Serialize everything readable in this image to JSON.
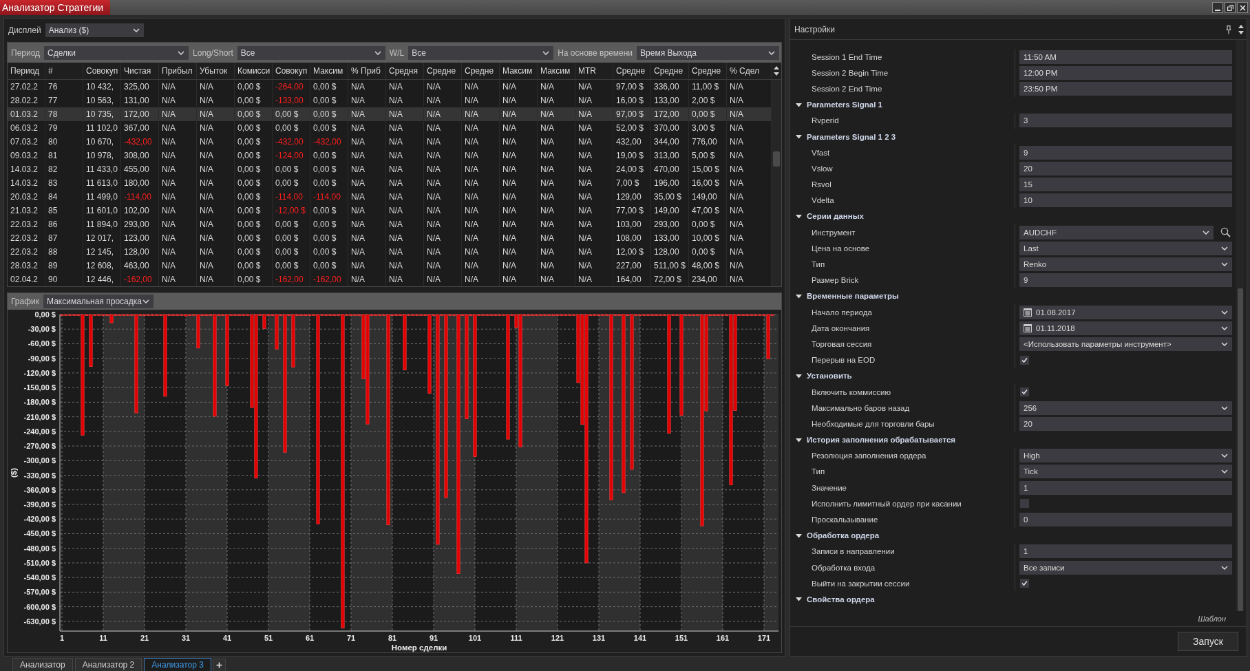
{
  "window": {
    "title": "Анализатор Стратегии"
  },
  "display": {
    "label": "Дисплей",
    "value": "Анализ ($)"
  },
  "filters": [
    {
      "label": "Период",
      "value": "Сделки"
    },
    {
      "label": "Long/Short",
      "value": "Все"
    },
    {
      "label": "W/L",
      "value": "Все"
    },
    {
      "label": "На основе времени",
      "value": "Время Выхода"
    }
  ],
  "table": {
    "columns": [
      "Период",
      "#",
      "Совокуп",
      "Чистая",
      "Прибыл",
      "Убыток",
      "Комисси",
      "Совокуп",
      "Максим",
      "% Приб",
      "Средня",
      "Средне",
      "Средне",
      "Максим",
      "Максим",
      "MTR",
      "Средне",
      "Средне",
      "Средне",
      "% Сдел"
    ],
    "rows": [
      {
        "selected": false,
        "cells": [
          "27.02.2",
          "76",
          "10 432,",
          "325,00",
          "N/A",
          "N/A",
          "0,00 $",
          {
            "text": "-264,00",
            "color": "#ff1e1e"
          },
          "0,00 $",
          "N/A",
          "N/A",
          "N/A",
          "N/A",
          "N/A",
          "N/A",
          "N/A",
          "97,00 $",
          "336,00",
          "11,00 $",
          "N/A"
        ]
      },
      {
        "selected": false,
        "cells": [
          "28.02.2",
          "77",
          "10 563,",
          "131,00",
          "N/A",
          "N/A",
          "0,00 $",
          {
            "text": "-133,00",
            "color": "#ff1e1e"
          },
          "0,00 $",
          "N/A",
          "N/A",
          "N/A",
          "N/A",
          "N/A",
          "N/A",
          "N/A",
          "16,00 $",
          "133,00",
          "2,00 $",
          "N/A"
        ]
      },
      {
        "selected": true,
        "cells": [
          "01.03.2",
          "78",
          "10 735,",
          "172,00",
          "N/A",
          "N/A",
          "0,00 $",
          "0,00 $",
          "0,00 $",
          "N/A",
          "N/A",
          "N/A",
          "N/A",
          "N/A",
          "N/A",
          "N/A",
          "97,00 $",
          "172,00",
          "0,00 $",
          "N/A"
        ]
      },
      {
        "selected": false,
        "cells": [
          "06.03.2",
          "79",
          "11 102,0",
          "367,00",
          "N/A",
          "N/A",
          "0,00 $",
          "0,00 $",
          "0,00 $",
          "N/A",
          "N/A",
          "N/A",
          "N/A",
          "N/A",
          "N/A",
          "N/A",
          "52,00 $",
          "370,00",
          "3,00 $",
          "N/A"
        ]
      },
      {
        "selected": false,
        "cells": [
          "07.03.2",
          "80",
          "10 670,",
          {
            "text": "-432,00",
            "color": "#ff1e1e"
          },
          "N/A",
          "N/A",
          "0,00 $",
          {
            "text": "-432,00",
            "color": "#ff1e1e"
          },
          {
            "text": "-432,00",
            "color": "#ff1e1e"
          },
          "N/A",
          "N/A",
          "N/A",
          "N/A",
          "N/A",
          "N/A",
          "N/A",
          "432,00",
          "344,00",
          "776,00",
          "N/A"
        ]
      },
      {
        "selected": false,
        "cells": [
          "09.03.2",
          "81",
          "10 978,",
          "308,00",
          "N/A",
          "N/A",
          "0,00 $",
          {
            "text": "-124,00",
            "color": "#ff1e1e"
          },
          "0,00 $",
          "N/A",
          "N/A",
          "N/A",
          "N/A",
          "N/A",
          "N/A",
          "N/A",
          "19,00 $",
          "313,00",
          "5,00 $",
          "N/A"
        ]
      },
      {
        "selected": false,
        "cells": [
          "14.03.2",
          "82",
          "11 433,0",
          "455,00",
          "N/A",
          "N/A",
          "0,00 $",
          "0,00 $",
          "0,00 $",
          "N/A",
          "N/A",
          "N/A",
          "N/A",
          "N/A",
          "N/A",
          "N/A",
          "24,00 $",
          "470,00",
          "15,00 $",
          "N/A"
        ]
      },
      {
        "selected": false,
        "cells": [
          "14.03.2",
          "83",
          "11 613,0",
          "180,00",
          "N/A",
          "N/A",
          "0,00 $",
          "0,00 $",
          "0,00 $",
          "N/A",
          "N/A",
          "N/A",
          "N/A",
          "N/A",
          "N/A",
          "N/A",
          "7,00 $",
          "196,00",
          "16,00 $",
          "N/A"
        ]
      },
      {
        "selected": false,
        "cells": [
          "20.03.2",
          "84",
          "11 499,0",
          {
            "text": "-114,00",
            "color": "#ff1e1e"
          },
          "N/A",
          "N/A",
          "0,00 $",
          {
            "text": "-114,00",
            "color": "#ff1e1e"
          },
          {
            "text": "-114,00",
            "color": "#ff1e1e"
          },
          "N/A",
          "N/A",
          "N/A",
          "N/A",
          "N/A",
          "N/A",
          "N/A",
          "129,00",
          "35,00 $",
          "149,00",
          "N/A"
        ]
      },
      {
        "selected": false,
        "cells": [
          "21.03.2",
          "85",
          "11 601,0",
          "102,00",
          "N/A",
          "N/A",
          "0,00 $",
          {
            "text": "-12,00 $",
            "color": "#ff1e1e"
          },
          "0,00 $",
          "N/A",
          "N/A",
          "N/A",
          "N/A",
          "N/A",
          "N/A",
          "N/A",
          "77,00 $",
          "149,00",
          "47,00 $",
          "N/A"
        ]
      },
      {
        "selected": false,
        "cells": [
          "22.03.2",
          "86",
          "11 894,0",
          "293,00",
          "N/A",
          "N/A",
          "0,00 $",
          "0,00 $",
          "0,00 $",
          "N/A",
          "N/A",
          "N/A",
          "N/A",
          "N/A",
          "N/A",
          "N/A",
          "103,00",
          "293,00",
          "0,00 $",
          "N/A"
        ]
      },
      {
        "selected": false,
        "cells": [
          "22.03.2",
          "87",
          "12 017,",
          "123,00",
          "N/A",
          "N/A",
          "0,00 $",
          "0,00 $",
          "0,00 $",
          "N/A",
          "N/A",
          "N/A",
          "N/A",
          "N/A",
          "N/A",
          "N/A",
          "108,00",
          "133,00",
          "10,00 $",
          "N/A"
        ]
      },
      {
        "selected": false,
        "cells": [
          "22.03.2",
          "88",
          "12 145,",
          "128,00",
          "N/A",
          "N/A",
          "0,00 $",
          "0,00 $",
          "0,00 $",
          "N/A",
          "N/A",
          "N/A",
          "N/A",
          "N/A",
          "N/A",
          "N/A",
          "12,00 $",
          "128,00",
          "0,00 $",
          "N/A"
        ]
      },
      {
        "selected": false,
        "cells": [
          "28.03.2",
          "89",
          "12 608,",
          "463,00",
          "N/A",
          "N/A",
          "0,00 $",
          "0,00 $",
          "0,00 $",
          "N/A",
          "N/A",
          "N/A",
          "N/A",
          "N/A",
          "N/A",
          "N/A",
          "227,00",
          "511,00 $",
          "48,00 $",
          "N/A"
        ]
      },
      {
        "selected": false,
        "cells": [
          "02.04.2",
          "90",
          "12 446,",
          {
            "text": "-162,00",
            "color": "#ff1e1e"
          },
          "N/A",
          "N/A",
          "0,00 $",
          {
            "text": "-162,00",
            "color": "#ff1e1e"
          },
          {
            "text": "-162,00",
            "color": "#ff1e1e"
          },
          "N/A",
          "N/A",
          "N/A",
          "N/A",
          "N/A",
          "N/A",
          "N/A",
          "164,00",
          "72,00 $",
          "234,00",
          "N/A"
        ]
      }
    ]
  },
  "chart_panel": {
    "label": "График",
    "value": "Максимальная просадка",
    "chart_data": {
      "type": "bar",
      "xlabel": "Номер сделки",
      "ylabel": "($)",
      "color": "#e00000",
      "grid": true,
      "x": [
        1,
        2,
        3,
        4,
        5,
        6,
        7,
        8,
        9,
        10,
        11,
        12,
        13,
        14,
        15,
        16,
        17,
        18,
        19,
        20,
        21,
        22,
        23,
        24,
        25,
        26,
        27,
        28,
        29,
        30,
        31,
        32,
        33,
        34,
        35,
        36,
        37,
        38,
        39,
        40,
        41,
        42,
        43,
        44,
        45,
        46,
        47,
        48,
        49,
        50,
        51,
        52,
        53,
        54,
        55,
        56,
        57,
        58,
        59,
        60,
        61,
        62,
        63,
        64,
        65,
        66,
        67,
        68,
        69,
        70,
        71,
        72,
        73,
        74,
        75,
        76,
        77,
        78,
        79,
        80,
        81,
        82,
        83,
        84,
        85,
        86,
        87,
        88,
        89,
        90,
        91,
        92,
        93,
        94,
        95,
        96,
        97,
        98,
        99,
        100,
        101,
        102,
        103,
        104,
        105,
        106,
        107,
        108,
        109,
        110,
        111,
        112,
        113,
        114,
        115,
        116,
        117,
        118,
        119,
        120,
        121,
        122,
        123,
        124,
        125,
        126,
        127,
        128,
        129,
        130,
        131,
        132,
        133,
        134,
        135,
        136,
        137,
        138,
        139,
        140,
        141,
        142,
        143,
        144,
        145,
        146,
        147,
        148,
        149,
        150,
        151,
        152,
        153,
        154,
        155,
        156,
        157,
        158,
        159,
        160,
        161,
        162,
        163,
        164,
        165,
        166,
        167,
        168,
        169,
        170,
        171,
        172,
        173
      ],
      "values": [
        0,
        0,
        0,
        0,
        0,
        -248,
        0,
        -107,
        0,
        0,
        0,
        0,
        -17,
        0,
        0,
        0,
        0,
        0,
        -202,
        0,
        0,
        0,
        0,
        0,
        0,
        -168,
        0,
        0,
        0,
        0,
        -3,
        0,
        0,
        -69,
        0,
        0,
        0,
        -209,
        0,
        0,
        -146,
        0,
        0,
        0,
        0,
        0,
        -191,
        -336,
        0,
        -29,
        0,
        0,
        -71,
        0,
        -283,
        0,
        -108,
        0,
        0,
        0,
        0,
        0,
        -430,
        0,
        0,
        0,
        0,
        0,
        -644,
        0,
        0,
        0,
        0,
        -132,
        -225,
        0,
        0,
        0,
        0,
        -432,
        0,
        0,
        0,
        -114,
        0,
        0,
        0,
        0,
        0,
        -162,
        0,
        -472,
        0,
        -376,
        0,
        0,
        -532,
        0,
        -214,
        0,
        -292,
        0,
        0,
        0,
        0,
        0,
        0,
        0,
        -256,
        0,
        -27,
        -272,
        0,
        0,
        0,
        0,
        0,
        0,
        0,
        0,
        0,
        0,
        0,
        0,
        0,
        -140,
        -226,
        -510,
        0,
        0,
        0,
        0,
        0,
        -381,
        0,
        0,
        -366,
        0,
        -318,
        0,
        0,
        0,
        0,
        0,
        0,
        0,
        0,
        -244,
        0,
        0,
        -207,
        0,
        0,
        0,
        0,
        -434,
        -198,
        0,
        0,
        0,
        0,
        0,
        -350,
        -197,
        0,
        0,
        0,
        0,
        0,
        0,
        0,
        -91,
        0
      ],
      "xlim": [
        0.5,
        174.5
      ],
      "ylim": [
        -650,
        0
      ],
      "xticks": [
        1,
        11,
        21,
        31,
        41,
        51,
        61,
        71,
        81,
        91,
        101,
        111,
        121,
        131,
        141,
        151,
        161,
        171
      ],
      "yticks": [
        {
          "value": 0,
          "label": "0,00 $"
        },
        {
          "value": -30,
          "label": "-30,00 $"
        },
        {
          "value": -60,
          "label": "-60,00 $"
        },
        {
          "value": -90,
          "label": "-90,00 $"
        },
        {
          "value": -120,
          "label": "-120,00 $"
        },
        {
          "value": -150,
          "label": "-150,00 $"
        },
        {
          "value": -180,
          "label": "-180,00 $"
        },
        {
          "value": -210,
          "label": "-210,00 $"
        },
        {
          "value": -240,
          "label": "-240,00 $"
        },
        {
          "value": -270,
          "label": "-270,00 $"
        },
        {
          "value": -300,
          "label": "-300,00 $"
        },
        {
          "value": -330,
          "label": "-330,00 $"
        },
        {
          "value": -360,
          "label": "-360,00 $"
        },
        {
          "value": -390,
          "label": "-390,00 $"
        },
        {
          "value": -420,
          "label": "-420,00 $"
        },
        {
          "value": -450,
          "label": "-450,00 $"
        },
        {
          "value": -480,
          "label": "-480,00 $"
        },
        {
          "value": -510,
          "label": "-510,00 $"
        },
        {
          "value": -540,
          "label": "-540,00 $"
        },
        {
          "value": -570,
          "label": "-570,00 $"
        },
        {
          "value": -600,
          "label": "-600,00 $"
        },
        {
          "value": -630,
          "label": "-630,00 $"
        }
      ]
    }
  },
  "settings": {
    "title": "Настройки",
    "items": [
      {
        "kind": "text",
        "label": "Session 1 End Time",
        "value": "11:50 AM"
      },
      {
        "kind": "text",
        "label": "Session 2 Begin Time",
        "value": "12:00 PM"
      },
      {
        "kind": "text",
        "label": "Session 2 End Time",
        "value": "23:50 PM"
      },
      {
        "kind": "category",
        "label": "Parameters Signal 1",
        "expanded": true,
        "children": [
          {
            "kind": "text",
            "label": "Rvperid",
            "value": "3"
          }
        ]
      },
      {
        "kind": "category",
        "label": "Parameters Signal 1 2 3",
        "expanded": true,
        "children": [
          {
            "kind": "text",
            "label": "Vfast",
            "value": "9"
          },
          {
            "kind": "text",
            "label": "Vslow",
            "value": "20"
          },
          {
            "kind": "text",
            "label": "Rsvol",
            "value": "15"
          },
          {
            "kind": "text",
            "label": "Vdelta",
            "value": "10"
          }
        ]
      },
      {
        "kind": "category",
        "label": "Серии данных",
        "expanded": true,
        "children": [
          {
            "kind": "instrument",
            "label": "Инструмент",
            "value": "AUDCHF"
          },
          {
            "kind": "dropdown",
            "label": "Цена на основе",
            "value": "Last"
          },
          {
            "kind": "dropdown",
            "label": "Тип",
            "value": "Renko"
          },
          {
            "kind": "text",
            "label": "Размер Brick",
            "value": "9"
          }
        ]
      },
      {
        "kind": "category",
        "label": "Временные параметры",
        "expanded": true,
        "children": [
          {
            "kind": "date",
            "label": "Начало периода",
            "value": "01.08.2017"
          },
          {
            "kind": "date",
            "label": "Дата окончания",
            "value": "01.11.2018"
          },
          {
            "kind": "dropdown",
            "label": "Торговая сессия",
            "value": "<Использовать параметры инструмент>"
          },
          {
            "kind": "checkbox",
            "label": "Перерыв на EOD",
            "checked": true
          }
        ]
      },
      {
        "kind": "category",
        "label": "Установить",
        "expanded": true,
        "children": [
          {
            "kind": "checkbox",
            "label": "Включить коммиссию",
            "checked": true
          },
          {
            "kind": "dropdown",
            "label": "Максимально баров назад",
            "value": "256"
          },
          {
            "kind": "text",
            "label": "Необходимые для торговли бары",
            "value": "20"
          }
        ]
      },
      {
        "kind": "category",
        "label": "История заполнения обрабатывается",
        "expanded": true,
        "children": [
          {
            "kind": "dropdown",
            "label": "Резолюция заполнения ордера",
            "value": "High"
          },
          {
            "kind": "dropdown",
            "label": "Тип",
            "value": "Tick"
          },
          {
            "kind": "text",
            "label": "Значение",
            "value": "1"
          },
          {
            "kind": "checkbox",
            "label": "Исполнить лимитный ордер при касании",
            "checked": false
          },
          {
            "kind": "text",
            "label": "Проскальзывание",
            "value": "0"
          }
        ]
      },
      {
        "kind": "category",
        "label": "Обработка ордера",
        "expanded": true,
        "children": [
          {
            "kind": "text",
            "label": "Записи в направлении",
            "value": "1"
          },
          {
            "kind": "dropdown",
            "label": "Обработка входа",
            "value": "Все записи"
          },
          {
            "kind": "checkbox",
            "label": "Выйти на закрытии сессии",
            "checked": true
          }
        ]
      },
      {
        "kind": "category",
        "label": "Свойства ордера",
        "expanded": true
      }
    ],
    "template_link": "Шаблон",
    "run_button": "Запуск"
  },
  "tabs": [
    {
      "label": "Анализатор",
      "selected": false
    },
    {
      "label": "Анализатор 2",
      "selected": false
    },
    {
      "label": "Анализатор 3",
      "selected": true
    }
  ]
}
